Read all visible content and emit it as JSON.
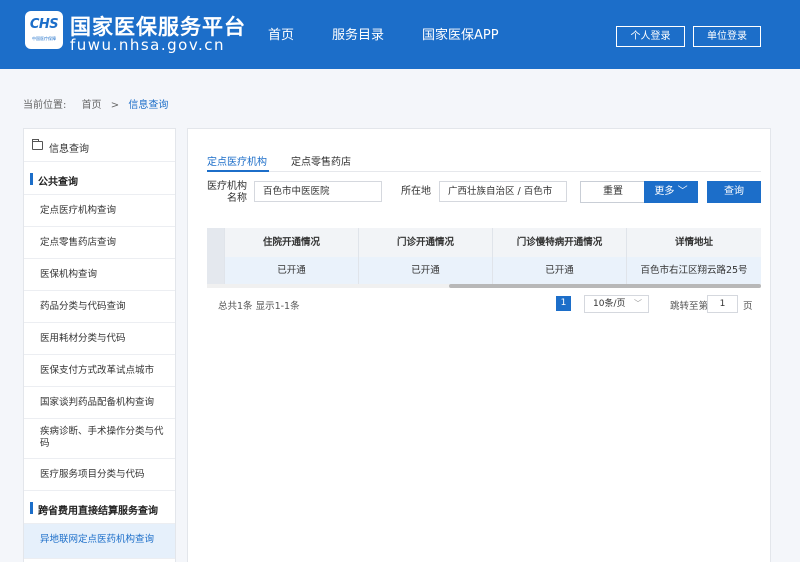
{
  "header": {
    "logo_text": "CHS",
    "logo_sub": "中国医疗保障",
    "title": "国家医保服务平台",
    "url": "fuwu.nhsa.gov.cn",
    "nav": [
      "首页",
      "服务目录",
      "国家医保APP"
    ],
    "personal_login": "个人登录",
    "unit_login": "单位登录",
    "color": "#1c6ec9"
  },
  "breadcrumb": {
    "prefix": "当前位置:",
    "home": "首页",
    "sep": ">",
    "current": "信息查询"
  },
  "sidebar": {
    "top_label": "信息查询",
    "section1": "公共查询",
    "items": [
      "定点医疗机构查询",
      "定点零售药店查询",
      "医保机构查询",
      "药品分类与代码查询",
      "医用耗材分类与代码",
      "医保支付方式改革试点城市",
      "国家谈判药品配备机构查询",
      "疾病诊断、手术操作分类与代码",
      "医疗服务项目分类与代码"
    ],
    "section2": "跨省费用直接结算服务查询",
    "active_item": "异地联网定点医药机构查询"
  },
  "tabs": [
    "定点医疗机构",
    "定点零售药店"
  ],
  "form": {
    "org_label_line1": "医疗机构",
    "org_label_line2": "名称",
    "org_value": "百色市中医医院",
    "location_label": "所在地",
    "location_value": "广西壮族自治区 / 百色市",
    "reset": "重置",
    "more": "更多",
    "query": "查询"
  },
  "table": {
    "headers": [
      "住院开通情况",
      "门诊开通情况",
      "门诊慢特病开通情况",
      "详情地址"
    ],
    "rows": [
      [
        "已开通",
        "已开通",
        "已开通",
        "百色市右江区翔云路25号"
      ]
    ]
  },
  "pagination": {
    "summary": "总共1条  显示1-1条",
    "current_page": "1",
    "page_size": "10条/页",
    "goto_label": "跳转至第",
    "goto_value": "1",
    "page_suffix": "页"
  }
}
